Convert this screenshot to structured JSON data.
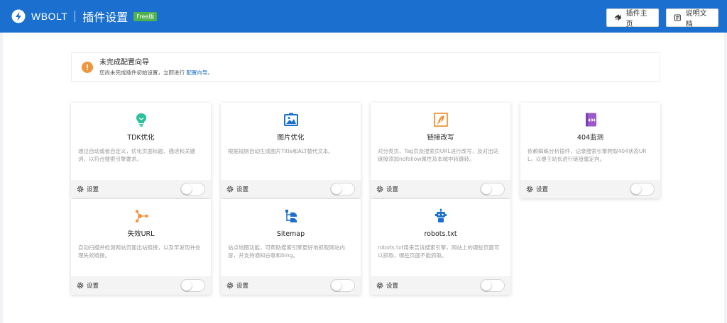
{
  "header": {
    "brand": "WBOLT",
    "title": "插件设置",
    "badge": "Free版",
    "btn_plugin_home": "插件主页",
    "btn_docs": "说明文档"
  },
  "notice": {
    "title": "未完成配置向导",
    "desc": "您尚未完成插件初始设置，立即进行",
    "link": "配置向导",
    "suffix": "。"
  },
  "settings_label": "设置",
  "modules": [
    {
      "title": "TDK优化",
      "desc": "通过自动或者自定义，优化页面标题、描述和关键词，以符合搜索引擎要求。",
      "icon": "lightbulb-icon",
      "enabled": false
    },
    {
      "title": "图片优化",
      "desc": "根据规则自动生成图片Title和ALT替代文本。",
      "icon": "image-icon",
      "enabled": false
    },
    {
      "title": "链接改写",
      "desc": "对分类页、Tag页及搜索页URL进行改写，及对出站链接添加nofollow属性及本域中转跳转。",
      "icon": "feather-pen-icon",
      "enabled": false
    },
    {
      "title": "404监测",
      "desc": "依赖蜘蛛分析插件，记录搜索引擎爬取404状态URL，以便于站长进行链接重定向。",
      "icon": "404-book-icon",
      "enabled": false
    },
    {
      "title": "失效URL",
      "desc": "自动扫描并检测网站页面出站链接，以及早发现并处理失效链接。",
      "icon": "link-nodes-icon",
      "enabled": false
    },
    {
      "title": "Sitemap",
      "desc": "站点地图功能，可帮助搜索引擎更好地抓取网站内容，并支持通知谷歌和bing。",
      "icon": "sitemap-icon",
      "enabled": false
    },
    {
      "title": "robots.txt",
      "desc": "robots.txt用来告诉搜索引擎，网站上的哪些页面可以抓取，哪些页面不能抓取。",
      "icon": "robot-icon",
      "enabled": false
    }
  ],
  "colors": {
    "brand_blue": "#1a6fcf",
    "badge_green": "#4fb24f",
    "notice_orange": "#f0953c"
  }
}
